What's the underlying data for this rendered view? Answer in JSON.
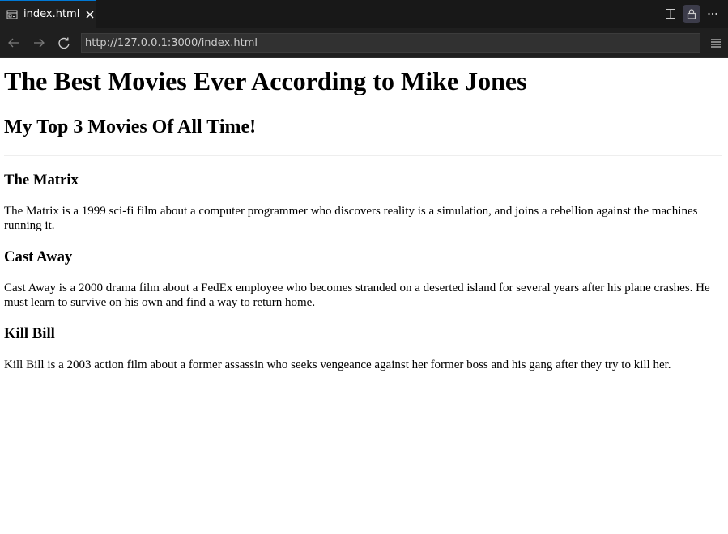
{
  "tab": {
    "title": "index.html",
    "icon": "preview-icon"
  },
  "toolbar": {
    "url": "http://127.0.0.1:3000/index.html",
    "icons": [
      "back-arrow-icon",
      "forward-arrow-icon",
      "reload-icon",
      "hamburger-menu-icon",
      "split-editor-icon",
      "lock-icon",
      "more-icon"
    ]
  },
  "page": {
    "title": "The Best Movies Ever According to Mike Jones",
    "subtitle": "My Top 3 Movies Of All Time!",
    "movies": [
      {
        "name": "The Matrix",
        "description": "The Matrix is a 1999 sci-fi film about a computer programmer who discovers reality is a simulation, and joins a rebellion against the machines running it."
      },
      {
        "name": "Cast Away",
        "description": "Cast Away is a 2000 drama film about a FedEx employee who becomes stranded on a deserted island for several years after his plane crashes. He must learn to survive on his own and find a way to return home."
      },
      {
        "name": "Kill Bill",
        "description": "Kill Bill is a 2003 action film about a former assassin who seeks vengeance against her former boss and his gang after they try to kill her."
      }
    ]
  },
  "colors": {
    "chrome_bg": "#1f1f1f",
    "tab_accent": "#0078d4",
    "url_bg": "#313131",
    "page_bg": "#ffffff"
  }
}
